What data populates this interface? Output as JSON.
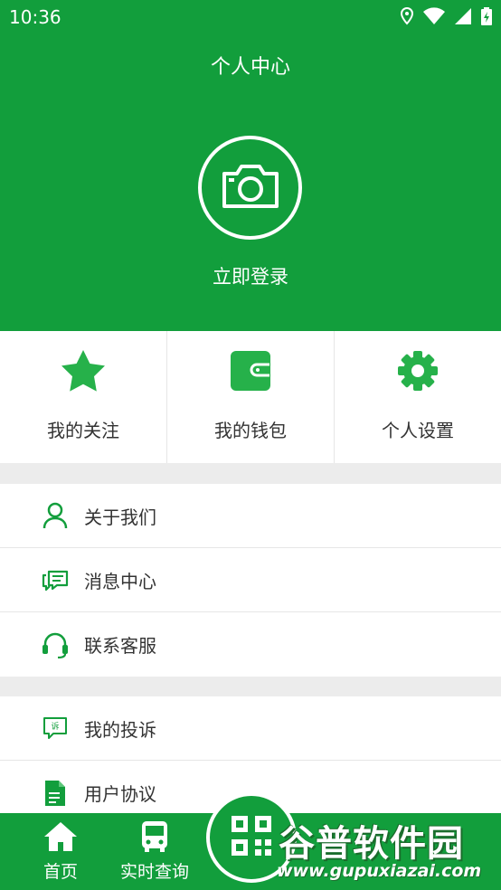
{
  "status_bar": {
    "time": "10:36",
    "icons": [
      "location-icon",
      "wifi-icon",
      "signal-icon",
      "battery-icon"
    ]
  },
  "header": {
    "title": "个人中心",
    "avatar_icon": "camera-icon",
    "login_label": "立即登录"
  },
  "quick_actions": [
    {
      "label": "我的关注",
      "icon": "star-icon"
    },
    {
      "label": "我的钱包",
      "icon": "wallet-icon"
    },
    {
      "label": "个人设置",
      "icon": "gear-icon"
    }
  ],
  "menu_group_1": [
    {
      "label": "关于我们",
      "icon": "user-icon"
    },
    {
      "label": "消息中心",
      "icon": "message-icon"
    },
    {
      "label": "联系客服",
      "icon": "headset-icon"
    }
  ],
  "menu_group_2": [
    {
      "label": "我的投诉",
      "icon": "complaint-icon"
    },
    {
      "label": "用户协议",
      "icon": "document-icon"
    }
  ],
  "tab_bar": {
    "items": [
      {
        "label": "首页",
        "icon": "home-icon"
      },
      {
        "label": "实时查询",
        "icon": "bus-icon"
      }
    ],
    "center_icon": "qr-code-icon"
  },
  "watermark": {
    "text": "谷普软件园",
    "url": "www.gupuxiazai.com"
  },
  "colors": {
    "primary": "#129e3c",
    "icon_green": "#26b14a",
    "text": "#333333",
    "divider": "#ececec"
  }
}
